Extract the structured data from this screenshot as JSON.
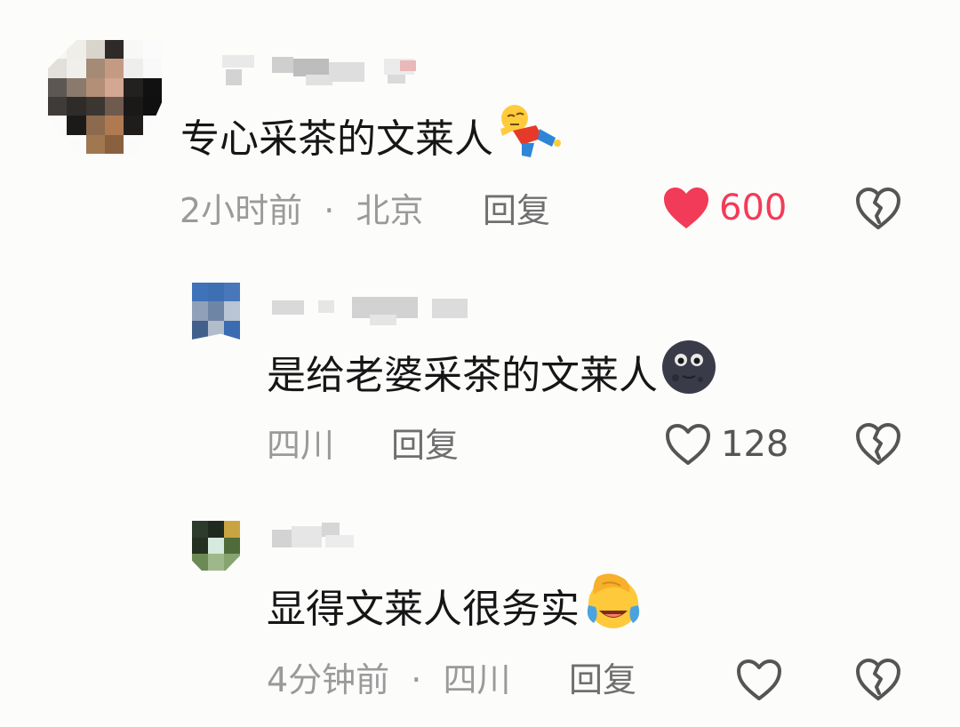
{
  "comments": [
    {
      "text": "专心采茶的文莱人",
      "emoji": "falling-person-emoji",
      "time": "2小时前",
      "location": "北京",
      "separator": "·",
      "reply_label": "回复",
      "liked": true,
      "like_count": "600",
      "like_color": "#f23b58"
    },
    {
      "text": "是给老婆采茶的文莱人",
      "emoji": "new-moon-face-emoji",
      "location": "四川",
      "reply_label": "回复",
      "liked": false,
      "like_count": "128"
    },
    {
      "text": "显得文莱人很务实",
      "emoji": "face-palm-laughing-emoji",
      "time": "4分钟前",
      "location": "四川",
      "separator": "·",
      "reply_label": "回复",
      "liked": false,
      "like_count": ""
    }
  ],
  "colors": {
    "background": "#fcfcfb",
    "text": "#161616",
    "meta": "#9a9a9a",
    "reply": "#6f6f6f",
    "like_active": "#f23b58",
    "icon": "#555555"
  }
}
